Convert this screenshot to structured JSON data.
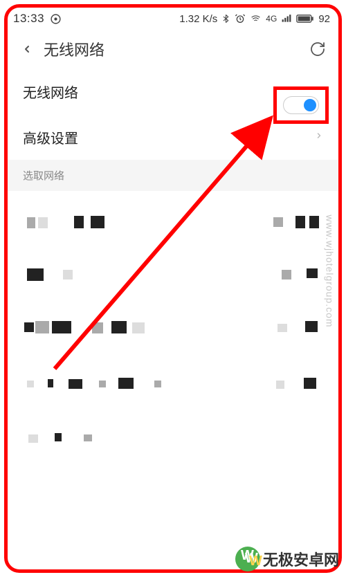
{
  "statusbar": {
    "time": "13:33",
    "net_speed": "1.32 K/s",
    "signal_label": "4G",
    "battery": "92"
  },
  "nav": {
    "title": "无线网络"
  },
  "rows": {
    "wifi_label": "无线网络",
    "advanced_label": "高级设置"
  },
  "section": {
    "select_network": "选取网络"
  },
  "watermark": {
    "url": "www.wjhotelgroup.com",
    "brand": "无极安卓网"
  }
}
